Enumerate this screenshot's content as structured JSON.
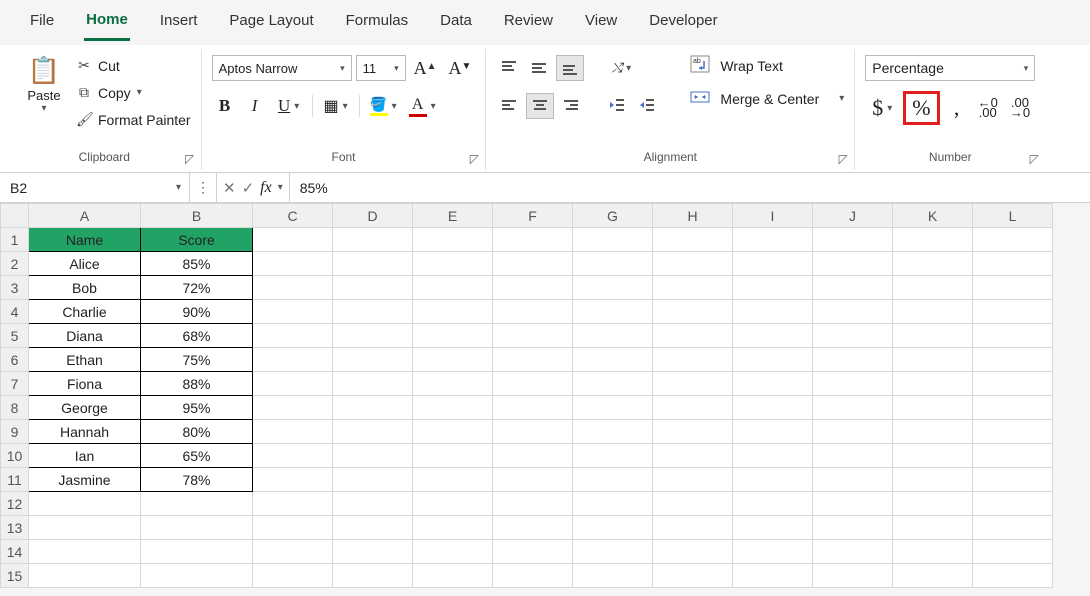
{
  "tabs": [
    "File",
    "Home",
    "Insert",
    "Page Layout",
    "Formulas",
    "Data",
    "Review",
    "View",
    "Developer"
  ],
  "active_tab": "Home",
  "clipboard": {
    "paste_label": "Paste",
    "cut_label": "Cut",
    "copy_label": "Copy",
    "format_painter_label": "Format Painter",
    "group_label": "Clipboard"
  },
  "font": {
    "name": "Aptos Narrow",
    "size": "11",
    "group_label": "Font"
  },
  "alignment": {
    "wrap_label": "Wrap Text",
    "merge_label": "Merge & Center",
    "group_label": "Alignment"
  },
  "number": {
    "format": "Percentage",
    "group_label": "Number"
  },
  "nameBox": "B2",
  "formula": "85%",
  "columns": [
    "A",
    "B",
    "C",
    "D",
    "E",
    "F",
    "G",
    "H",
    "I",
    "J",
    "K",
    "L"
  ],
  "rowNumbers": [
    "1",
    "2",
    "3",
    "4",
    "5",
    "6",
    "7",
    "8",
    "9",
    "10",
    "11",
    "12",
    "13",
    "14",
    "15"
  ],
  "table": {
    "headers": [
      "Name",
      "Score"
    ],
    "rows": [
      {
        "name": "Alice",
        "score": "85%"
      },
      {
        "name": "Bob",
        "score": "72%"
      },
      {
        "name": "Charlie",
        "score": "90%"
      },
      {
        "name": "Diana",
        "score": "68%"
      },
      {
        "name": "Ethan",
        "score": "75%"
      },
      {
        "name": "Fiona",
        "score": "88%"
      },
      {
        "name": "George",
        "score": "95%"
      },
      {
        "name": "Hannah",
        "score": "80%"
      },
      {
        "name": "Ian",
        "score": "65%"
      },
      {
        "name": "Jasmine",
        "score": "78%"
      }
    ]
  }
}
